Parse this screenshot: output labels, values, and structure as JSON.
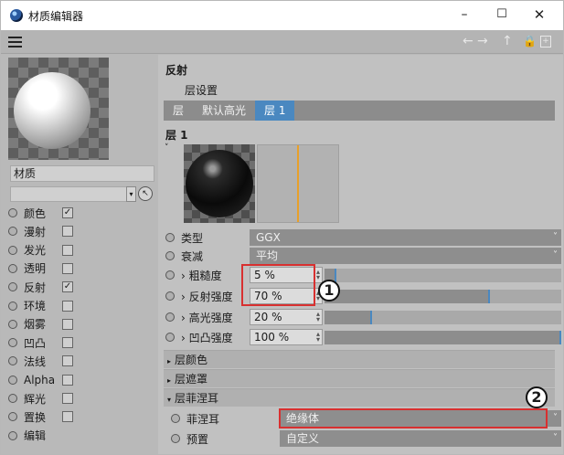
{
  "window": {
    "title": "材质编辑器",
    "controls": {
      "minimize": "–",
      "maximize": "☐",
      "close": "✕"
    }
  },
  "toolbar": {
    "back": "←",
    "forward": "→",
    "up": "↑",
    "lock": "🔒",
    "new": "+"
  },
  "left": {
    "material_name": "材质",
    "channels": [
      {
        "label": "颜色",
        "checked": true
      },
      {
        "label": "漫射",
        "checked": false
      },
      {
        "label": "发光",
        "checked": false
      },
      {
        "label": "透明",
        "checked": false
      },
      {
        "label": "反射",
        "checked": true
      },
      {
        "label": "环境",
        "checked": false
      },
      {
        "label": "烟雾",
        "checked": false
      },
      {
        "label": "凹凸",
        "checked": false
      },
      {
        "label": "法线",
        "checked": false
      },
      {
        "label": "Alpha",
        "checked": false
      },
      {
        "label": "辉光",
        "checked": false
      },
      {
        "label": "置换",
        "checked": false
      },
      {
        "label": "编辑",
        "checked": null
      }
    ]
  },
  "right": {
    "section_title": "反射",
    "layer_settings": "层设置",
    "tabs": [
      "层",
      "默认高光",
      "层 1"
    ],
    "active_tab": 2,
    "layer_name": "层 1",
    "type": {
      "label": "类型",
      "value": "GGX"
    },
    "attenuation": {
      "label": "衰减",
      "value": "平均"
    },
    "roughness": {
      "label": "› 粗糙度",
      "value": "5 %",
      "level": 0.05
    },
    "reflect_strength": {
      "label": "› 反射强度",
      "value": "70 %",
      "level": 0.7
    },
    "specular_strength": {
      "label": "› 高光强度",
      "value": "20 %",
      "level": 0.2
    },
    "bump_strength": {
      "label": "› 凹凸强度",
      "value": "100 %",
      "level": 1.0
    },
    "groups": {
      "layer_color": "层颜色",
      "layer_mask": "层遮罩",
      "layer_fresnel": "层菲涅耳"
    },
    "fresnel": {
      "label": "菲涅耳",
      "value": "绝缘体"
    },
    "preset": {
      "label": "预置",
      "value": "自定义"
    }
  },
  "annotations": {
    "badge1": "1",
    "badge2": "2"
  },
  "colors": {
    "accent": "#4a88c0",
    "highlight": "#d83030",
    "falloff_line": "#e8a02a"
  }
}
